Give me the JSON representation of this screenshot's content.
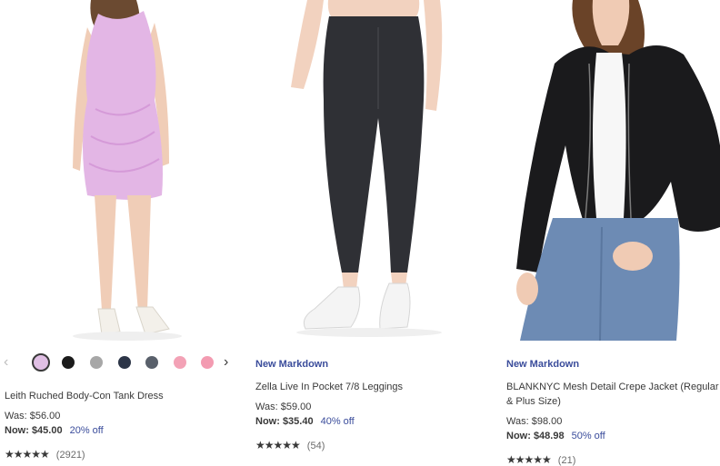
{
  "products": [
    {
      "label": "",
      "title": "Leith Ruched Body-Con Tank Dress",
      "was": "Was: $56.00",
      "now": "Now: $45.00",
      "discount": "20% off",
      "stars": "★★★★★",
      "rating_value": 4.5,
      "reviews": "(2921)",
      "swatches": [
        "#e0bfe4",
        "#1b1b1b",
        "#a7a7a7",
        "#2c3547",
        "#59606b",
        "#f3a2b6",
        "#f39bb1"
      ],
      "selected_swatch": 0
    },
    {
      "label": "New Markdown",
      "title": "Zella Live In Pocket 7/8 Leggings",
      "was": "Was: $59.00",
      "now": "Now: $35.40",
      "discount": "40% off",
      "stars": "★★★★★",
      "rating_value": 4.5,
      "reviews": "(54)"
    },
    {
      "label": "New Markdown",
      "title": "BLANKNYC Mesh Detail Crepe Jacket (Regular & Plus Size)",
      "was": "Was: $98.00",
      "now": "Now: $48.98",
      "discount": "50% off",
      "stars": "★★★★★",
      "rating_value": 4.5,
      "reviews": "(21)"
    }
  ],
  "icons": {
    "prev": "chevron-left-icon",
    "next": "chevron-right-icon",
    "prev_glyph": "‹",
    "next_glyph": "›"
  },
  "colors": {
    "accent": "#3a4c9b",
    "text": "#393939"
  }
}
